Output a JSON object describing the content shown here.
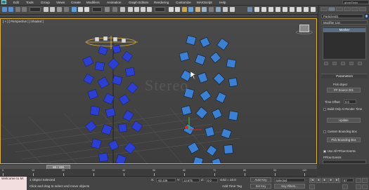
{
  "menubar": {
    "items": [
      "Edit",
      "Tools",
      "Group",
      "Views",
      "Create",
      "Modifiers",
      "Animation",
      "Graph Editors",
      "Rendering",
      "Customize",
      "MAXScript",
      "Help"
    ],
    "search_placeholder": "ghostTown"
  },
  "viewport": {
    "label": "[ + ] [ Perspective ] [ Shaded ]",
    "watermark": "Stereo"
  },
  "command_panel": {
    "object_name": "Particles01",
    "modifier_list": "Modifier List",
    "stack_item": "Mesher",
    "parameters_title": "Parameters",
    "pick_object": "Pick object",
    "pf_source": "PF Source 001",
    "time_offset_label": "Time Offset:",
    "time_offset_value": "0.0",
    "build_only_label": "Build Only At Render Time",
    "update_label": "Update",
    "custom_bbox_label": "Custom Bounding Box",
    "pick_bbox_label": "Pick Bounding Box",
    "use_all_label": "Use All PFlow Events",
    "pflow_events_label": "PFlow Events"
  },
  "timeline": {
    "slider_label": "68 / 100",
    "ticks": [
      "0",
      "10",
      "20",
      "30",
      "40",
      "50",
      "60",
      "70",
      "80",
      "90",
      "100"
    ]
  },
  "status": {
    "script_text": "Welcome to M:",
    "status_line": "1 Object Selected",
    "prompt_line": "Click and drag to select and move objects",
    "x_label": "X:",
    "x_value": "-82.436",
    "y_label": "Y:",
    "y_value": "13.675",
    "z_label": "Z:",
    "z_value": "0.0",
    "grid": "Grid = 10.0",
    "add_time_tag": "Add Time Tag",
    "auto_key": "Auto Key",
    "auto_key_mode": "Selected",
    "set_key": "Set Key",
    "key_filters": "Key Filters...",
    "frame": "67"
  }
}
